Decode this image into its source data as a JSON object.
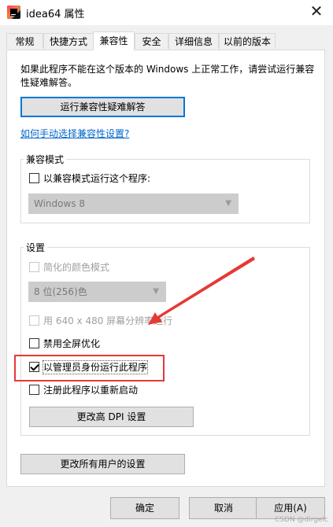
{
  "window": {
    "title": "idea64 属性",
    "close_glyph": "✕"
  },
  "tabs": [
    {
      "label": "常规"
    },
    {
      "label": "快捷方式"
    },
    {
      "label": "兼容性"
    },
    {
      "label": "安全"
    },
    {
      "label": "详细信息"
    },
    {
      "label": "以前的版本"
    }
  ],
  "active_tab": "兼容性",
  "compat": {
    "intro": "如果此程序不能在这个版本的 Windows 上正常工作，请尝试运行兼容性疑难解答。",
    "troubleshoot_button": "运行兼容性疑难解答",
    "manual_link": "如何手动选择兼容性设置?",
    "mode_group": {
      "label": "兼容模式",
      "checkbox": "以兼容模式运行这个程序:",
      "select_value": "Windows 8"
    },
    "settings_group": {
      "label": "设置",
      "reduced_color": "简化的颜色模式",
      "color_select_value": "8 位(256)色",
      "resolution": "用 640 x 480 屏幕分辨率运行",
      "disable_fullscreen": "禁用全屏优化",
      "run_as_admin": "以管理员身份运行此程序",
      "register_restart": "注册此程序以重新启动",
      "dpi_button": "更改高 DPI 设置"
    },
    "all_users_button": "更改所有用户的设置"
  },
  "footer": {
    "ok": "确定",
    "cancel": "取消",
    "apply": "应用(A)"
  },
  "watermark": "CSDN @dirgelc",
  "colors": {
    "accent": "#0078d7",
    "highlight": "#e53935",
    "link": "#0066cc"
  }
}
